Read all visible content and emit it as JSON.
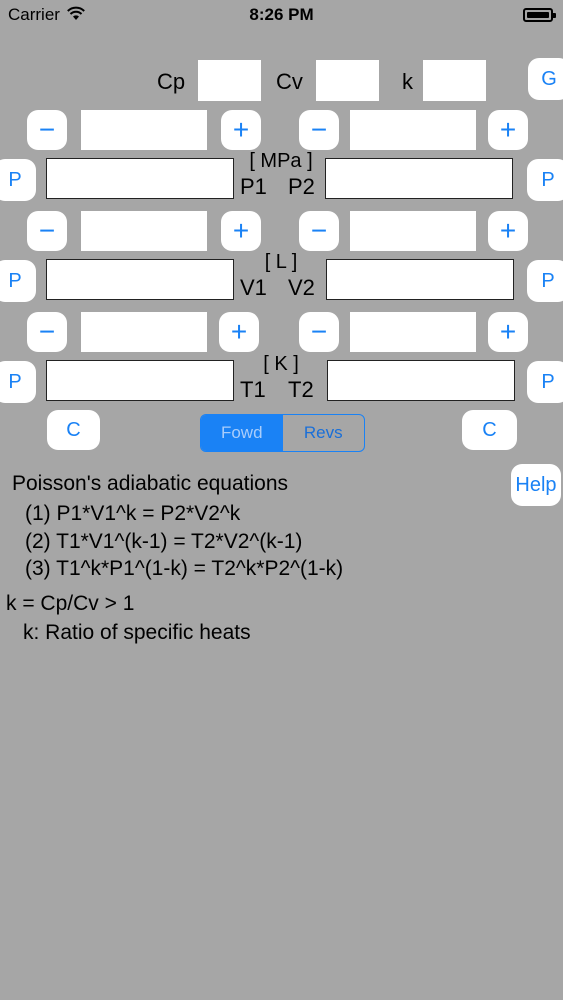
{
  "status": {
    "carrier": "Carrier",
    "time": "8:26 PM"
  },
  "header": {
    "cp_label": "Cp",
    "cv_label": "Cv",
    "k_label": "k",
    "g_button": "G"
  },
  "controls": {
    "minus": "−",
    "plus": "+",
    "p_button": "P",
    "c_button": "C"
  },
  "pressure": {
    "unit": "[ MPa ]",
    "left_label": "P1",
    "right_label": "P2"
  },
  "volume": {
    "unit": "[ L ]",
    "left_label": "V1",
    "right_label": "V2"
  },
  "temperature": {
    "unit": "[ K ]",
    "left_label": "T1",
    "right_label": "T2"
  },
  "segment": {
    "forward": "Fowd",
    "reverse": "Revs",
    "selected": "Fowd"
  },
  "help_button": "Help",
  "info": {
    "title": "Poisson's adiabatic equations",
    "eq1": "(1) P1*V1^k = P2*V2^k",
    "eq2": "(2) T1*V1^(k-1) = T2*V2^(k-1)",
    "eq3": "(3) T1^k*P1^(1-k) = T2^k*P2^(1-k)",
    "k_def": "k = Cp/Cv > 1",
    "k_note": "k: Ratio of specific heats"
  },
  "colors": {
    "background": "#a6a6a6",
    "accent": "#1a82f5"
  }
}
